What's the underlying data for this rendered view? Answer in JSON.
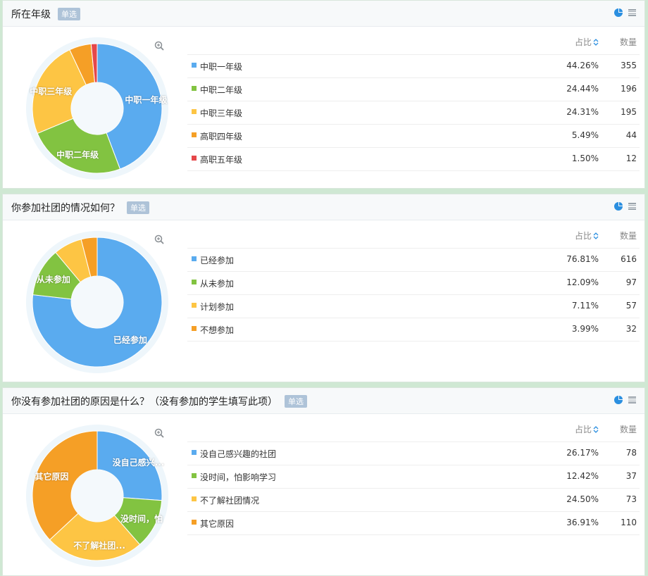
{
  "colors": {
    "blue": "#5aabef",
    "green": "#82c341",
    "yellow": "#fdc544",
    "orange": "#f59f26",
    "red": "#e5474a"
  },
  "header_labels": {
    "percent": "占比",
    "count": "数量"
  },
  "questions": [
    {
      "title": "所在年级",
      "tag": "单选",
      "options": [
        {
          "label": "中职一年级",
          "pct": "44.26%",
          "count": "355",
          "value": 44.26,
          "color": "blue",
          "slice_label": "中职一年级"
        },
        {
          "label": "中职二年级",
          "pct": "24.44%",
          "count": "196",
          "value": 24.44,
          "color": "green",
          "slice_label": "中职二年级"
        },
        {
          "label": "中职三年级",
          "pct": "24.31%",
          "count": "195",
          "value": 24.31,
          "color": "yellow",
          "slice_label": "中职三年级"
        },
        {
          "label": "高职四年级",
          "pct": "5.49%",
          "count": "44",
          "value": 5.49,
          "color": "orange",
          "slice_label": ""
        },
        {
          "label": "高职五年级",
          "pct": "1.50%",
          "count": "12",
          "value": 1.5,
          "color": "red",
          "slice_label": ""
        }
      ]
    },
    {
      "title": "你参加社团的情况如何？",
      "tag": "单选",
      "options": [
        {
          "label": "已经参加",
          "pct": "76.81%",
          "count": "616",
          "value": 76.81,
          "color": "blue",
          "slice_label": "已经参加"
        },
        {
          "label": "从未参加",
          "pct": "12.09%",
          "count": "97",
          "value": 12.09,
          "color": "green",
          "slice_label": "从未参加"
        },
        {
          "label": "计划参加",
          "pct": "7.11%",
          "count": "57",
          "value": 7.11,
          "color": "yellow",
          "slice_label": ""
        },
        {
          "label": "不想参加",
          "pct": "3.99%",
          "count": "32",
          "value": 3.99,
          "color": "orange",
          "slice_label": ""
        }
      ]
    },
    {
      "title": "你没有参加社团的原因是什么？（没有参加的学生填写此项）",
      "tag": "单选",
      "options": [
        {
          "label": "没自己感兴趣的社团",
          "pct": "26.17%",
          "count": "78",
          "value": 26.17,
          "color": "blue",
          "slice_label": "没自己感兴..."
        },
        {
          "label": "没时间，怕影响学习",
          "pct": "12.42%",
          "count": "37",
          "value": 12.42,
          "color": "green",
          "slice_label": "没时间，怕"
        },
        {
          "label": "不了解社团情况",
          "pct": "24.50%",
          "count": "73",
          "value": 24.5,
          "color": "yellow",
          "slice_label": "不了解社团..."
        },
        {
          "label": "其它原因",
          "pct": "36.91%",
          "count": "110",
          "value": 36.91,
          "color": "orange",
          "slice_label": "其它原因"
        }
      ]
    }
  ]
}
